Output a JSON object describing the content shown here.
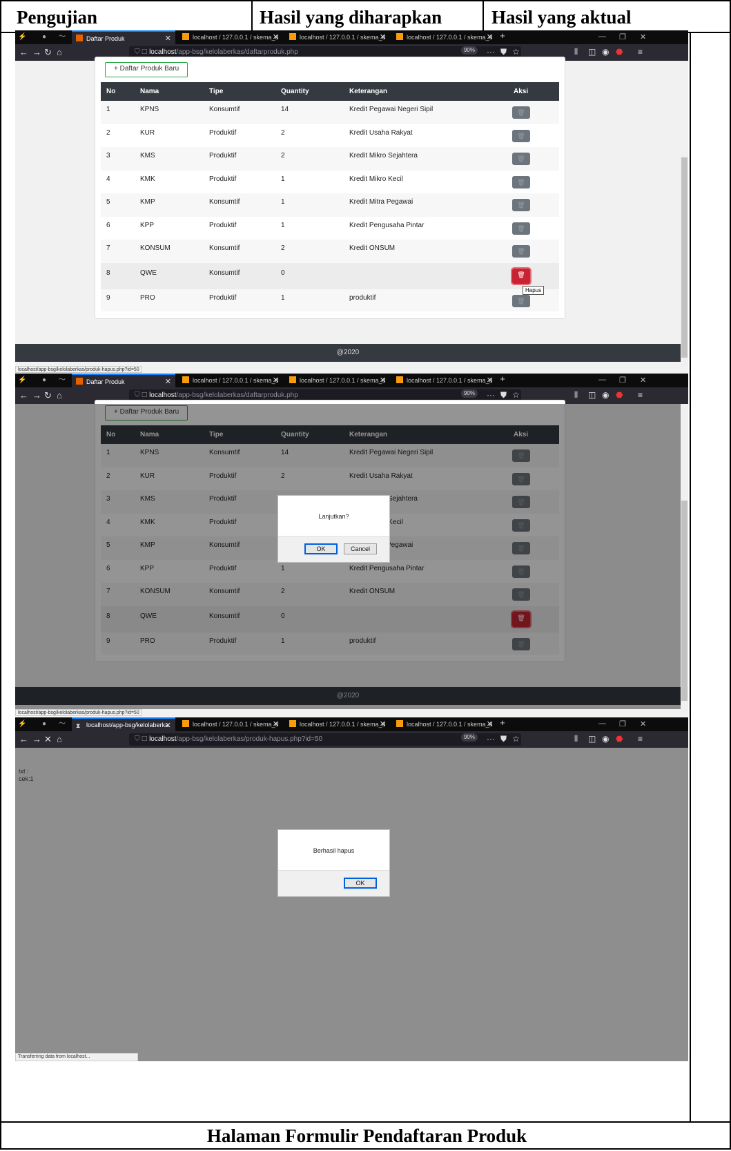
{
  "doc": {
    "header": [
      "Pengujian",
      "Hasil yang diharapkan",
      "Hasil yang aktual"
    ],
    "caption": "Halaman Formulir Pendaftaran Produk"
  },
  "colors": {
    "danger": "#c82333",
    "dark": "#343a40",
    "success_border": "#28a745",
    "browser_bg": "#0c0c0d"
  },
  "browser": {
    "tabs_common": [
      "localhost / 127.0.0.1 / skema_d",
      "localhost / 127.0.0.1 / skema_d",
      "localhost / 127.0.0.1 / skema_d"
    ],
    "tab_active_1": "Daftar Produk",
    "tab_active_3": "localhost/app-bsg/kelolaberka",
    "new_tab": "+",
    "url_host": "localhost",
    "url_path_list": "/app-bsg/kelolaberkas/daftarproduk.php",
    "url_path_hapus": "/app-bsg/kelolaberkas/produk-hapus.php?id=50",
    "zoom": "90%",
    "status_hover": "localhost/app-bsg/kelolaberkas/produk-hapus.php?id=50",
    "status_loading": "Transferring data from localhost..."
  },
  "page": {
    "add_button": "+ Daftar Produk Baru",
    "columns": [
      "No",
      "Nama",
      "Tipe",
      "Quantity",
      "Keterangan",
      "Aksi"
    ],
    "rows": [
      {
        "no": "1",
        "nama": "KPNS",
        "tipe": "Konsumtif",
        "qty": "14",
        "ket": "Kredit Pegawai Negeri Sipil"
      },
      {
        "no": "2",
        "nama": "KUR",
        "tipe": "Produktif",
        "qty": "2",
        "ket": "Kredit Usaha Rakyat"
      },
      {
        "no": "3",
        "nama": "KMS",
        "tipe": "Produktif",
        "qty": "2",
        "ket": "Kredit Mikro Sejahtera"
      },
      {
        "no": "4",
        "nama": "KMK",
        "tipe": "Produktif",
        "qty": "1",
        "ket": "Kredit Mikro Kecil"
      },
      {
        "no": "5",
        "nama": "KMP",
        "tipe": "Konsumtif",
        "qty": "1",
        "ket": "Kredit Mitra Pegawai"
      },
      {
        "no": "6",
        "nama": "KPP",
        "tipe": "Produktif",
        "qty": "1",
        "ket": "Kredit Pengusaha Pintar"
      },
      {
        "no": "7",
        "nama": "KONSUM",
        "tipe": "Konsumtif",
        "qty": "2",
        "ket": "Kredit ONSUM"
      },
      {
        "no": "8",
        "nama": "QWE",
        "tipe": "Konsumtif",
        "qty": "0",
        "ket": ""
      },
      {
        "no": "9",
        "nama": "PRO",
        "tipe": "Produktif",
        "qty": "1",
        "ket": "produktif"
      }
    ],
    "tooltip": "Hapus",
    "footer": "@2020",
    "delete_icon": "trash-icon"
  },
  "confirm_dialog": {
    "message": "Lanjutkan?",
    "ok": "OK",
    "cancel": "Cancel"
  },
  "result": {
    "output_text": "txt :\ncek:1",
    "message": "Berhasil hapus",
    "ok": "OK"
  }
}
